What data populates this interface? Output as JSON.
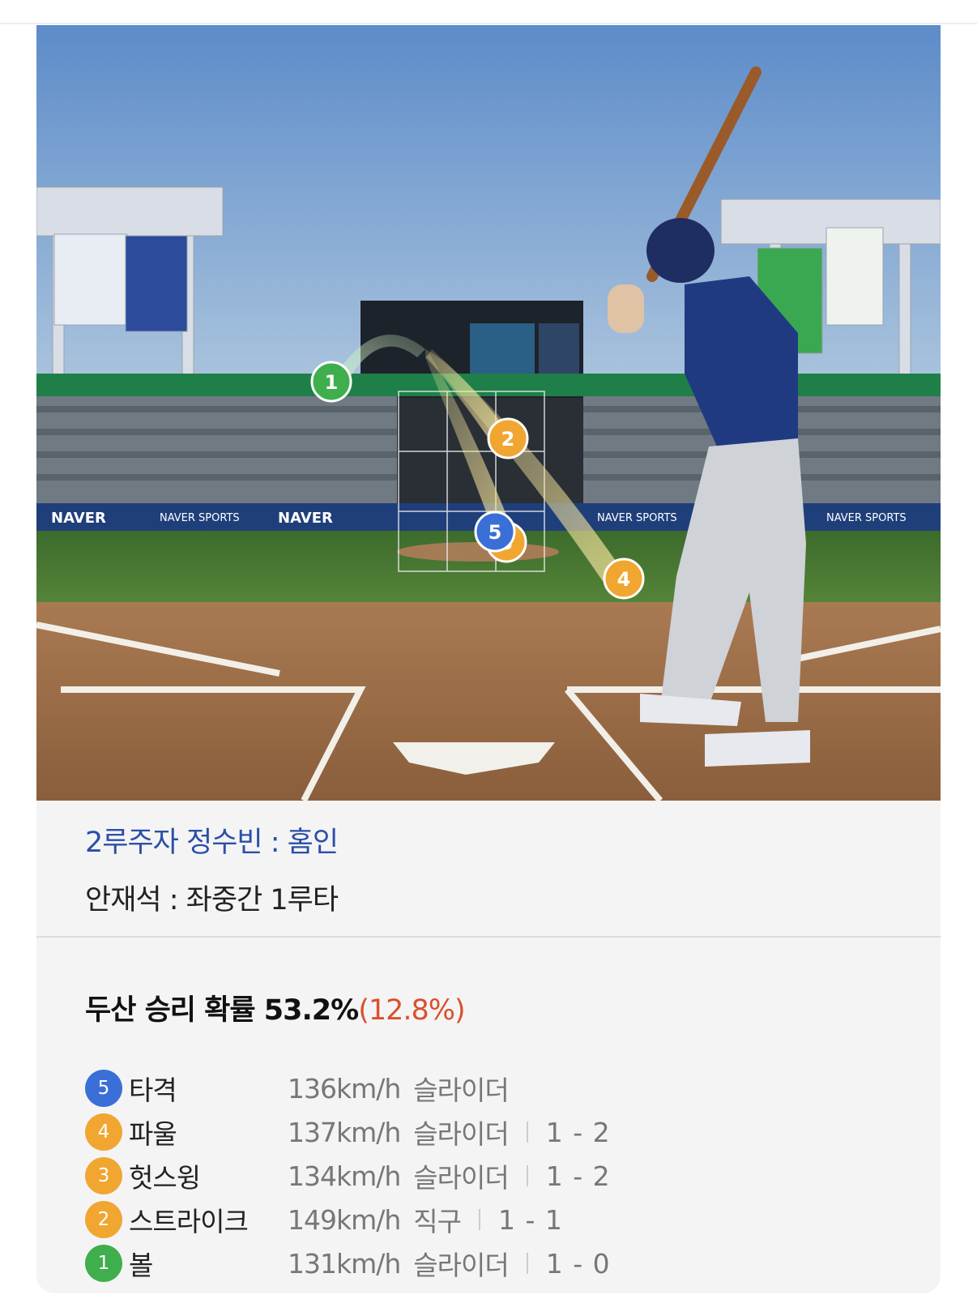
{
  "colors": {
    "blue": "#3a6fd8",
    "orange": "#f0a630",
    "green": "#3fae4d",
    "runner_text": "#2b4fa8",
    "delta_text": "#d9502c"
  },
  "scene": {
    "banners": [
      "NAVER",
      "NAVER SPORTS",
      "NAVER",
      "NAVER SPORTS",
      "NAVER SPORTS"
    ],
    "markers": [
      "1",
      "2",
      "5",
      "3",
      "4"
    ]
  },
  "play": {
    "runner": "2루주자 정수빈 : 홈인",
    "batter": "안재석 : 좌중간 1루타"
  },
  "win_probability": {
    "label": "두산 승리 확률 53.2%",
    "delta": "(12.8%)"
  },
  "pitches": [
    {
      "num": "5",
      "color": "blue",
      "result": "타격",
      "speed": "136km/h",
      "pitch": "슬라이더",
      "count": ""
    },
    {
      "num": "4",
      "color": "orange",
      "result": "파울",
      "speed": "137km/h",
      "pitch": "슬라이더",
      "count": "1 - 2"
    },
    {
      "num": "3",
      "color": "orange",
      "result": "헛스윙",
      "speed": "134km/h",
      "pitch": "슬라이더",
      "count": "1 - 2"
    },
    {
      "num": "2",
      "color": "orange",
      "result": "스트라이크",
      "speed": "149km/h",
      "pitch": "직구",
      "count": "1 - 1"
    },
    {
      "num": "1",
      "color": "green",
      "result": "볼",
      "speed": "131km/h",
      "pitch": "슬라이더",
      "count": "1 - 0"
    }
  ]
}
